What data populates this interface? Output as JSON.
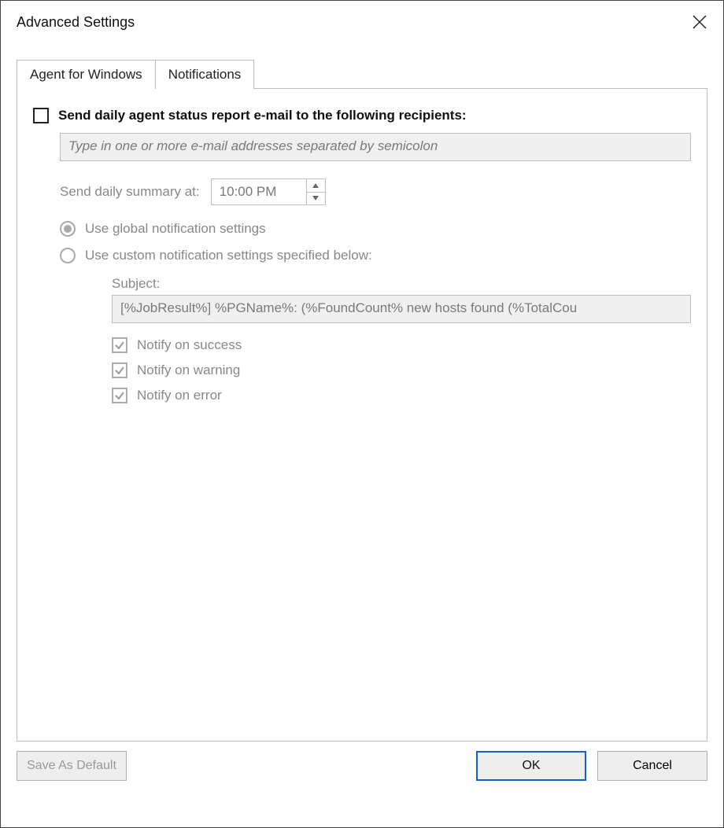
{
  "dialog": {
    "title": "Advanced Settings"
  },
  "tabs": {
    "items": [
      {
        "label": "Agent for Windows",
        "active": false
      },
      {
        "label": "Notifications",
        "active": true
      }
    ]
  },
  "notifications": {
    "send_daily_label": "Send daily agent status report e-mail to the following recipients:",
    "send_daily_checked": false,
    "email_placeholder": "Type in one or more e-mail addresses separated by semicolon",
    "email_value": "",
    "summary_label": "Send daily summary at:",
    "summary_time": "10:00 PM",
    "radio_global_label": "Use global notification settings",
    "radio_custom_label": "Use custom notification settings specified below:",
    "radio_selected": "global",
    "subject_label": "Subject:",
    "subject_value": "[%JobResult%] %PGName%: (%FoundCount% new hosts found (%TotalCou",
    "notify_success_label": "Notify on success",
    "notify_success_checked": true,
    "notify_warning_label": "Notify on warning",
    "notify_warning_checked": true,
    "notify_error_label": "Notify on error",
    "notify_error_checked": true
  },
  "footer": {
    "save_default_label": "Save As Default",
    "ok_label": "OK",
    "cancel_label": "Cancel"
  }
}
